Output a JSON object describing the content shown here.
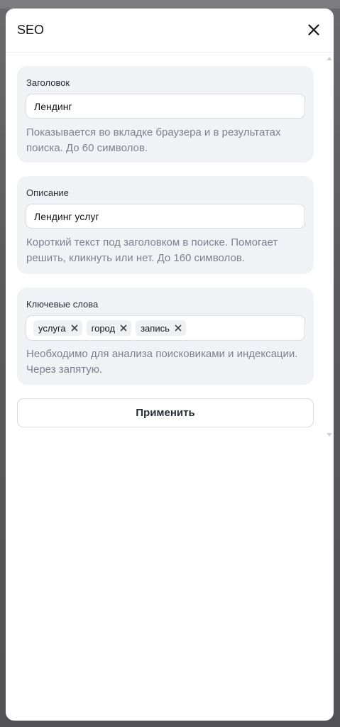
{
  "modal": {
    "title": "SEO",
    "close_icon": "close-icon"
  },
  "title_field": {
    "label": "Заголовок",
    "value": "Лендинг",
    "hint": "Показывается во вкладке браузера и в результатах поиска. До 60 символов."
  },
  "description_field": {
    "label": "Описание",
    "value": "Лендинг услуг",
    "hint": "Короткий текст под заголовком в поиске. Помогает решить, кликнуть или нет. До 160 символов."
  },
  "keywords_field": {
    "label": "Ключевые слова",
    "tags": [
      "услуга",
      "город",
      "запись"
    ],
    "hint": "Необходимо для анализа поисковиками и индексации. Через запятую.",
    "remove_icon": "x-icon"
  },
  "apply_button": {
    "label": "Применить"
  },
  "colors": {
    "card_bg": "#f1f2f5",
    "hint_text": "#7d8290",
    "overlay": "#5e5e62"
  }
}
